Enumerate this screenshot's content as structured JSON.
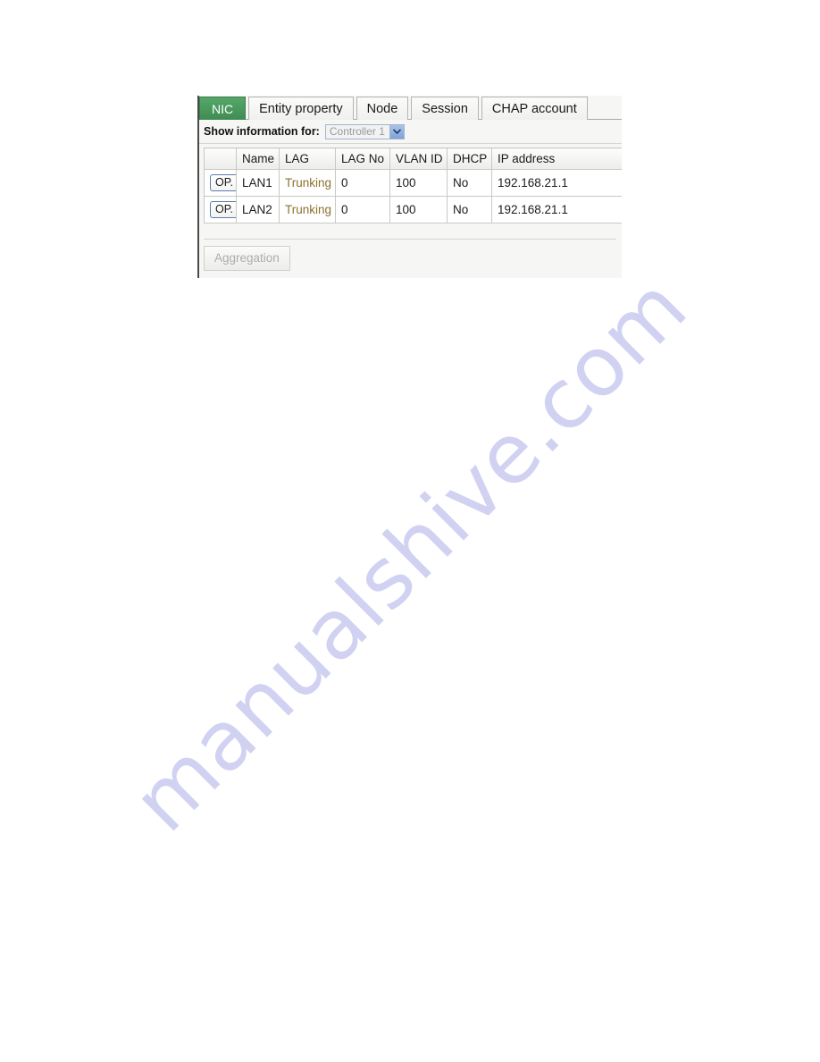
{
  "watermark": {
    "text": "manualshive.com",
    "color": "#c9caf0"
  },
  "panel": {
    "tabs": [
      {
        "label": "NIC",
        "active": true
      },
      {
        "label": "Entity property",
        "active": false
      },
      {
        "label": "Node",
        "active": false
      },
      {
        "label": "Session",
        "active": false
      },
      {
        "label": "CHAP account",
        "active": false
      }
    ],
    "filter": {
      "label": "Show information for:",
      "select_value": "Controller 1",
      "select_icon": "chevron-down-icon",
      "disabled": true
    },
    "table": {
      "headers": [
        "",
        "Name",
        "LAG",
        "LAG No",
        "VLAN ID",
        "DHCP",
        "IP address"
      ],
      "rows": [
        {
          "op_label": "OP.",
          "name": "LAN1",
          "lag": "Trunking",
          "lag_no": "0",
          "vlan_id": "100",
          "dhcp": "No",
          "ip_address": "192.168.21.1"
        },
        {
          "op_label": "OP.",
          "name": "LAN2",
          "lag": "Trunking",
          "lag_no": "0",
          "vlan_id": "100",
          "dhcp": "No",
          "ip_address": "192.168.21.1"
        }
      ]
    },
    "footer": {
      "aggregation_label": "Aggregation",
      "aggregation_disabled": true
    },
    "colors": {
      "active_tab_green": "#4a9a5e",
      "lag_text": "#8a7230",
      "select_arrow_blue": "#7ea4d6"
    }
  }
}
